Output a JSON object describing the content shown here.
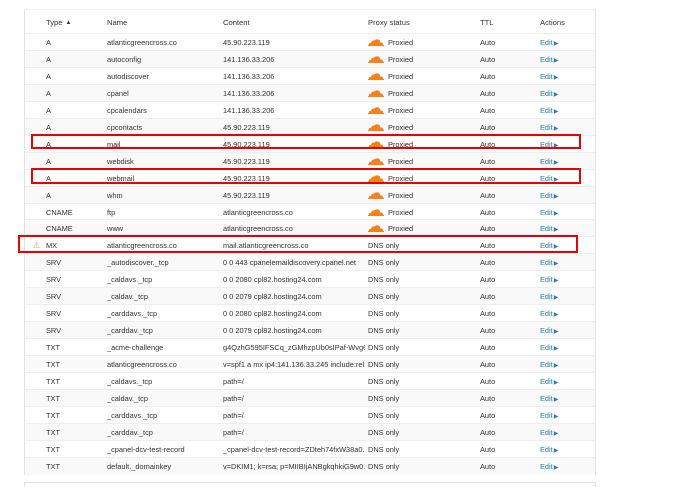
{
  "table": {
    "headers": {
      "type": "Type",
      "name": "Name",
      "content": "Content",
      "proxy": "Proxy status",
      "ttl": "TTL",
      "actions": "Actions"
    },
    "sort_indicator": "▲",
    "edit_label": "Edit",
    "rows": [
      {
        "type": "A",
        "name": "atlanticgreencross.co",
        "content": "45.90.223.119",
        "proxy": "Proxied",
        "ttl": "Auto",
        "proxied": true
      },
      {
        "type": "A",
        "name": "autoconfig",
        "content": "141.136.33.206",
        "proxy": "Proxied",
        "ttl": "Auto",
        "proxied": true
      },
      {
        "type": "A",
        "name": "autodiscover",
        "content": "141.136.33.206",
        "proxy": "Proxied",
        "ttl": "Auto",
        "proxied": true
      },
      {
        "type": "A",
        "name": "cpanel",
        "content": "141.136.33.206",
        "proxy": "Proxied",
        "ttl": "Auto",
        "proxied": true
      },
      {
        "type": "A",
        "name": "cpcalendars",
        "content": "141.136.33.206",
        "proxy": "Proxied",
        "ttl": "Auto",
        "proxied": true
      },
      {
        "type": "A",
        "name": "cpcontacts",
        "content": "45.90.223.119",
        "proxy": "Proxied",
        "ttl": "Auto",
        "proxied": true
      },
      {
        "type": "A",
        "name": "mail",
        "content": "45.90.223.119",
        "proxy": "Proxied",
        "ttl": "Auto",
        "proxied": true
      },
      {
        "type": "A",
        "name": "webdisk",
        "content": "45.90.223.119",
        "proxy": "Proxied",
        "ttl": "Auto",
        "proxied": true
      },
      {
        "type": "A",
        "name": "webmail",
        "content": "45.90.223.119",
        "proxy": "Proxied",
        "ttl": "Auto",
        "proxied": true
      },
      {
        "type": "A",
        "name": "whm",
        "content": "45.90.223.119",
        "proxy": "Proxied",
        "ttl": "Auto",
        "proxied": true
      },
      {
        "type": "CNAME",
        "name": "ftp",
        "content": "atlanticgreencross.co",
        "proxy": "Proxied",
        "ttl": "Auto",
        "proxied": true
      },
      {
        "type": "CNAME",
        "name": "www",
        "content": "atlanticgreencross.co",
        "proxy": "Proxied",
        "ttl": "Auto",
        "proxied": true
      },
      {
        "type": "MX",
        "name": "atlanticgreencross.co",
        "content": "mail.atlanticgreencross.co",
        "proxy": "DNS only",
        "ttl": "Auto",
        "proxied": false,
        "warning": "⚠"
      },
      {
        "type": "SRV",
        "name": "_autodiscover._tcp",
        "content": "0 0 443 cpanelemaildiscovery.cpanel.net",
        "proxy": "DNS only",
        "ttl": "Auto",
        "proxied": false
      },
      {
        "type": "SRV",
        "name": "_caldavs._tcp",
        "content": "0 0 2080 cpl82.hosting24.com",
        "proxy": "DNS only",
        "ttl": "Auto",
        "proxied": false
      },
      {
        "type": "SRV",
        "name": "_caldav._tcp",
        "content": "0 0 2079 cpl82.hosting24.com",
        "proxy": "DNS only",
        "ttl": "Auto",
        "proxied": false
      },
      {
        "type": "SRV",
        "name": "_carddavs._tcp",
        "content": "0 0 2080 cpl82.hosting24.com",
        "proxy": "DNS only",
        "ttl": "Auto",
        "proxied": false
      },
      {
        "type": "SRV",
        "name": "_carddav._tcp",
        "content": "0 0 2079 cpl82.hosting24.com",
        "proxy": "DNS only",
        "ttl": "Auto",
        "proxied": false
      },
      {
        "type": "TXT",
        "name": "_acme-challenge",
        "content": "g4QzhG595IFSCq_zGMhzpUb0sIPaf-Wvg65...",
        "proxy": "DNS only",
        "ttl": "Auto",
        "proxied": false
      },
      {
        "type": "TXT",
        "name": "atlanticgreencross.co",
        "content": "v=spf1 a mx ip4:141.136.33.245 include:rel...",
        "proxy": "DNS only",
        "ttl": "Auto",
        "proxied": false
      },
      {
        "type": "TXT",
        "name": "_caldavs._tcp",
        "content": "path=/",
        "proxy": "DNS only",
        "ttl": "Auto",
        "proxied": false
      },
      {
        "type": "TXT",
        "name": "_caldav._tcp",
        "content": "path=/",
        "proxy": "DNS only",
        "ttl": "Auto",
        "proxied": false
      },
      {
        "type": "TXT",
        "name": "_carddavs._tcp",
        "content": "path=/",
        "proxy": "DNS only",
        "ttl": "Auto",
        "proxied": false
      },
      {
        "type": "TXT",
        "name": "_carddav._tcp",
        "content": "path=/",
        "proxy": "DNS only",
        "ttl": "Auto",
        "proxied": false
      },
      {
        "type": "TXT",
        "name": "_cpanel-dcv-test-record",
        "content": "_cpanel-dcv-test-record=ZDteh74fxW38a0...",
        "proxy": "DNS only",
        "ttl": "Auto",
        "proxied": false
      },
      {
        "type": "TXT",
        "name": "default._domainkey",
        "content": "v=DKIM1; k=rsa; p=MIIBIjANBgkqhkiG9w0...",
        "proxy": "DNS only",
        "ttl": "Auto",
        "proxied": false
      }
    ]
  },
  "colors": {
    "cloud_orange": "#f6821f",
    "edit_link": "#2c7cb0",
    "highlight_red": "#e60000",
    "warning": "#e8a33b"
  },
  "icons": {
    "proxied": "cloud-icon",
    "warning": "warning-icon",
    "sort": "sort-ascending-icon",
    "edit": "caret-right-icon"
  }
}
